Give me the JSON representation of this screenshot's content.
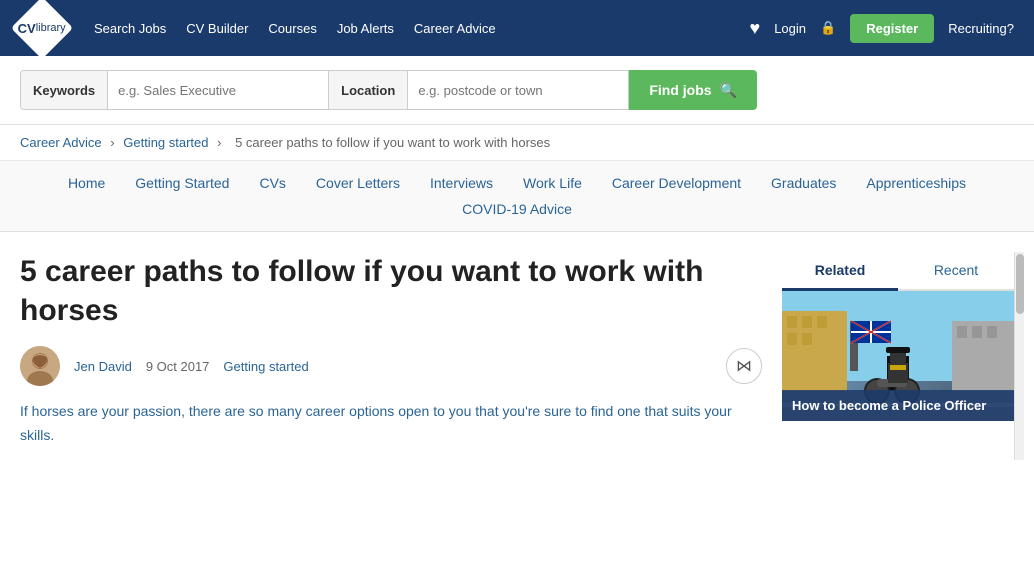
{
  "header": {
    "logo_cv": "CV",
    "logo_library": "library",
    "nav": {
      "search_jobs": "Search Jobs",
      "cv_builder": "CV Builder",
      "courses": "Courses",
      "job_alerts": "Job Alerts",
      "career_advice": "Career Advice"
    },
    "login": "Login",
    "register": "Register",
    "recruiting": "Recruiting?"
  },
  "search": {
    "keywords_label": "Keywords",
    "keywords_placeholder": "e.g. Sales Executive",
    "location_label": "Location",
    "location_placeholder": "e.g. postcode or town",
    "find_jobs_btn": "Find jobs"
  },
  "breadcrumb": {
    "career_advice": "Career Advice",
    "getting_started": "Getting started",
    "current_page": "5 career paths to follow if you want to work with horses"
  },
  "category_nav": {
    "primary": [
      "Home",
      "Getting Started",
      "CVs",
      "Cover Letters",
      "Interviews",
      "Work Life",
      "Career Development",
      "Graduates",
      "Apprenticeships"
    ],
    "secondary": [
      "COVID-19 Advice"
    ]
  },
  "article": {
    "title": "5 career paths to follow if you want to work with horses",
    "author": "Jen David",
    "date": "9 Oct 2017",
    "category": "Getting started",
    "body_p1": "If horses are your passion, there are so many career options open to you that you're sure to find one that suits your skills."
  },
  "sidebar": {
    "tab_related": "Related",
    "tab_recent": "Recent",
    "card_title": "How to become a Police Officer"
  }
}
